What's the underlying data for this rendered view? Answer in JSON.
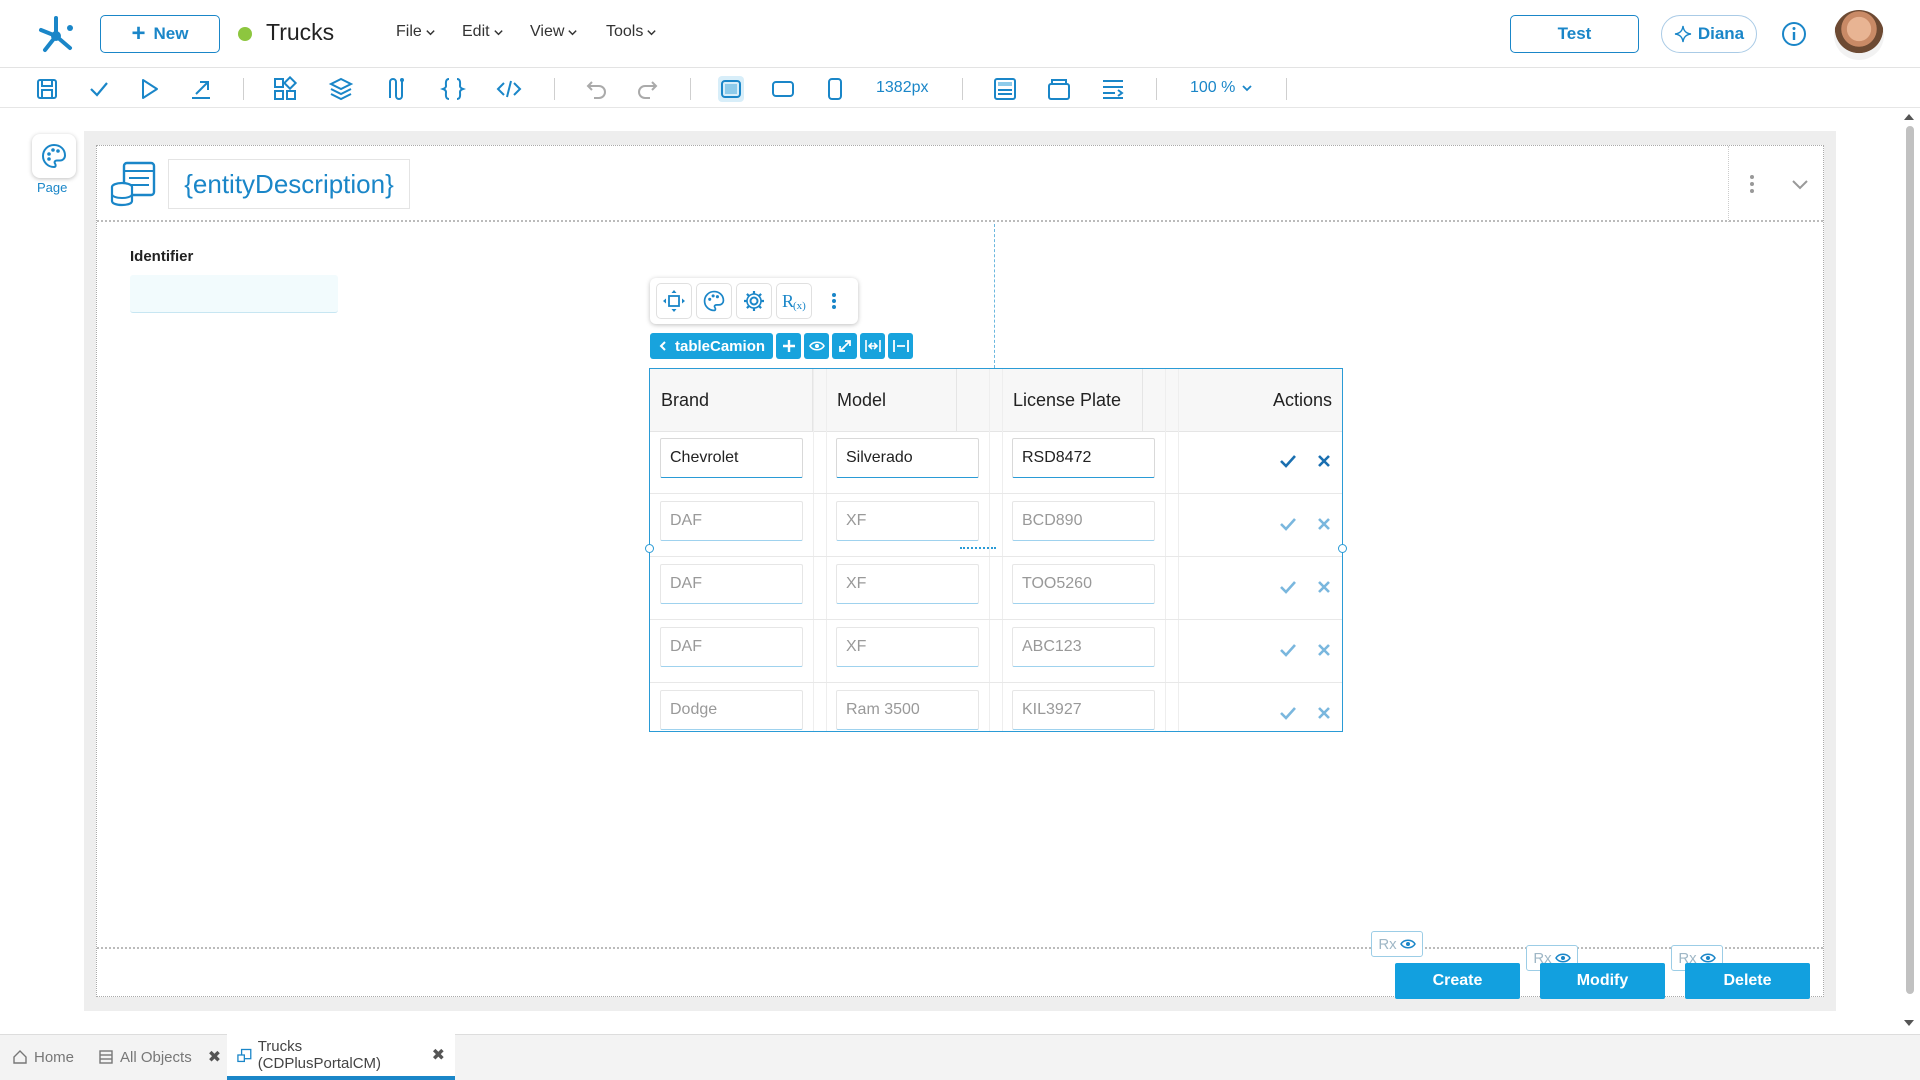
{
  "topbar": {
    "new_label": "New",
    "app_title": "Trucks",
    "status_color": "#8dc63f",
    "menus": [
      "File",
      "Edit",
      "View",
      "Tools"
    ],
    "test_label": "Test",
    "user_label": "Diana"
  },
  "toolbar": {
    "width_value": "1382px",
    "zoom_value": "100 %"
  },
  "sidebar": {
    "page_label": "Page"
  },
  "form": {
    "entity_description": "{entityDescription}",
    "identifier_label": "Identifier",
    "identifier_value": ""
  },
  "table": {
    "selected_name": "tableCamion",
    "columns": [
      "Brand",
      "Model",
      "License Plate",
      "Actions"
    ],
    "rows": [
      {
        "brand": "Chevrolet",
        "model": "Silverado",
        "plate": "RSD8472"
      },
      {
        "brand": "DAF",
        "model": "XF",
        "plate": "BCD890"
      },
      {
        "brand": "DAF",
        "model": "XF",
        "plate": "TOO5260"
      },
      {
        "brand": "DAF",
        "model": "XF",
        "plate": "ABC123"
      },
      {
        "brand": "Dodge",
        "model": "Ram 3500",
        "plate": "KIL3927"
      }
    ]
  },
  "footer": {
    "rx_label": "Rx",
    "create_label": "Create",
    "modify_label": "Modify",
    "delete_label": "Delete"
  },
  "bottom_tabs": {
    "home": "Home",
    "all_objects": "All Objects",
    "trucks": "Trucks (CDPlusPortalCM)"
  },
  "colors": {
    "accent": "#1a86c8",
    "selection": "#18a3dd",
    "button": "#12a0df"
  }
}
